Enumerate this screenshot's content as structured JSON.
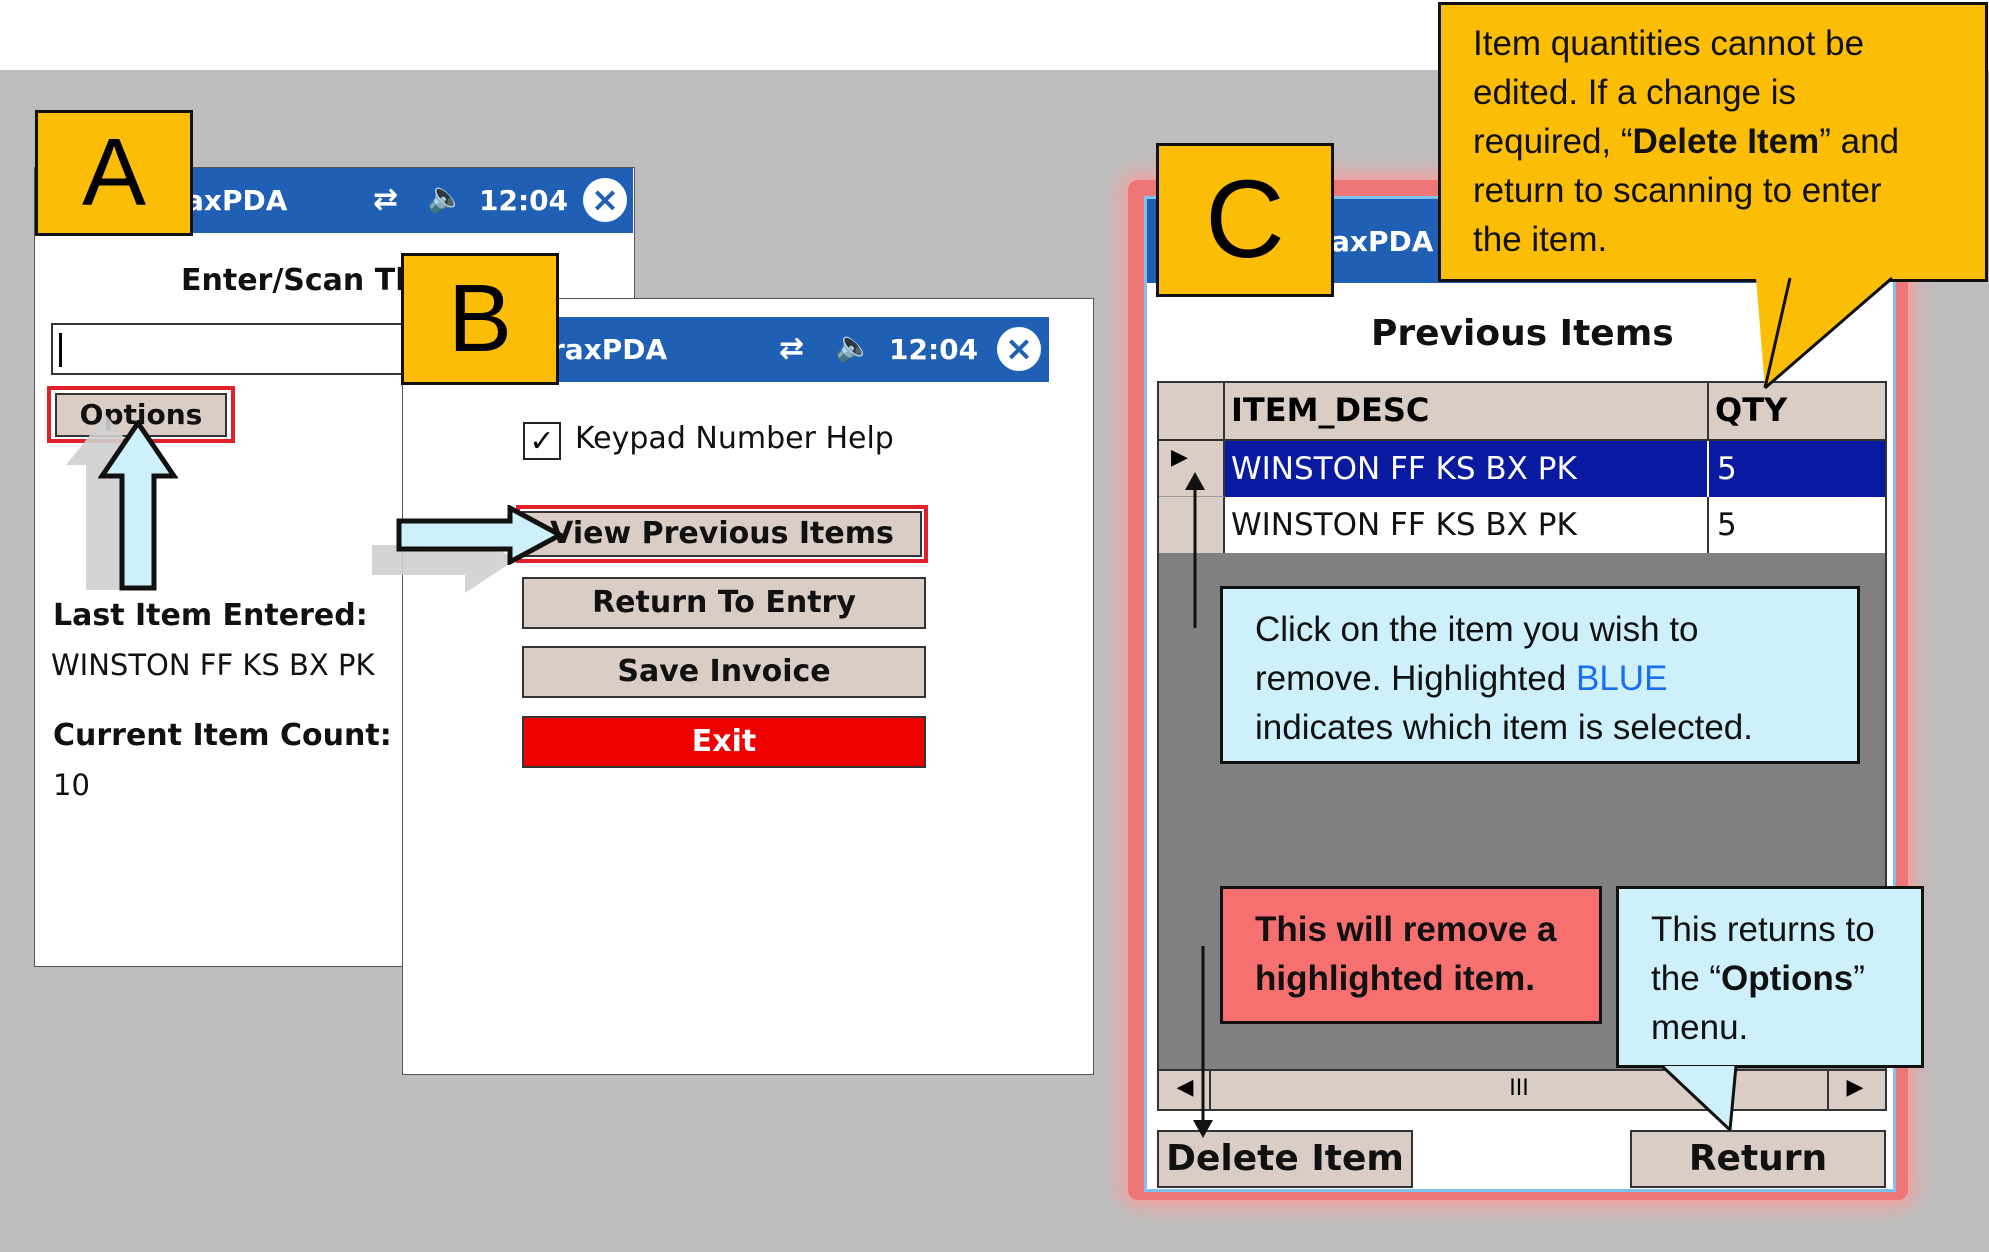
{
  "window_a": {
    "label": "A",
    "title": "axPDA",
    "time": "12:04",
    "prompt": "Enter/Scan Th",
    "options_button": "Options",
    "last_item_label": "Last Item Entered:",
    "last_item_value": "WINSTON FF KS BX PK",
    "count_label": "Current Item Count:",
    "count_value": "10"
  },
  "window_b": {
    "label": "B",
    "title": "raxPDA",
    "time": "12:04",
    "checkbox_label": "Keypad Number Help",
    "checkbox_checked": true,
    "buttons": {
      "view_previous": "View Previous Items",
      "return_to_entry": "Return To Entry",
      "save_invoice": "Save Invoice",
      "exit": "Exit"
    }
  },
  "window_c": {
    "label": "C",
    "title": "axPDA",
    "heading": "Previous Items",
    "columns": [
      "ITEM_DESC",
      "QTY"
    ],
    "rows": [
      {
        "desc": "WINSTON FF KS BX PK",
        "qty": "5",
        "selected": true
      },
      {
        "desc": "WINSTON FF KS BX PK",
        "qty": "5",
        "selected": false
      }
    ],
    "scroll_thumb": "III",
    "delete_button": "Delete Item",
    "return_button": "Return"
  },
  "callouts": {
    "top_right": {
      "line1": "Item quantities cannot be",
      "line2": "edited. If a change is",
      "line3_pre": "required, “",
      "line3_bold": "Delete Item",
      "line3_post": "” and",
      "line4": "return to scanning to enter",
      "line5": "the item."
    },
    "click_info": {
      "line1": "Click on the item you wish to",
      "line2_pre": "remove. Highlighted ",
      "line2_blue": "BLUE",
      "line3": "indicates which item is selected."
    },
    "remove_info": {
      "line1": "This will remove a",
      "line2": "highlighted item."
    },
    "return_info": {
      "line1": "This returns to",
      "line2_pre": "the “",
      "line2_bold": "Options",
      "line2_post": "”",
      "line3": "menu."
    }
  },
  "colors": {
    "label_yellow": "#fbbd06",
    "titlebar_blue": "#1f5fb4",
    "selected_row": "#0a1aa0",
    "exit_red": "#ee0000",
    "callout_blue": "#cdf0fb",
    "callout_red": "#f77070",
    "highlight_red": "#e0202a",
    "blue_text": "#1a6ff0"
  }
}
